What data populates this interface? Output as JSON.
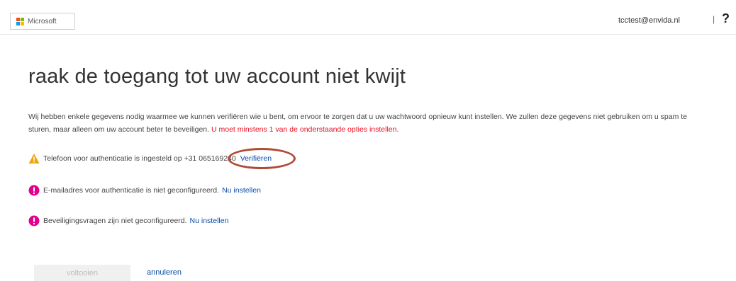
{
  "header": {
    "brand": "Microsoft",
    "user_email": "tcctest@envida.nl",
    "divider": "|",
    "help": "?"
  },
  "main": {
    "title": "raak de toegang tot uw account niet kwijt",
    "intro_text": "Wij hebben enkele gegevens nodig waarmee we kunnen verifiëren wie u bent, om ervoor te zorgen dat u uw wachtwoord opnieuw kunt instellen. We zullen deze gegevens niet gebruiken om u spam te sturen, maar alleen om uw account beter te beveiligen.",
    "intro_warning": "U moet minstens 1 van de onderstaande opties instellen.",
    "items": [
      {
        "icon": "warning-icon",
        "text": "Telefoon voor authenticatie is ingesteld op +31 065169240",
        "link": "Verifiëren"
      },
      {
        "icon": "error-icon",
        "text": "E-mailadres voor authenticatie is niet geconfigureerd.",
        "link": "Nu instellen"
      },
      {
        "icon": "error-icon",
        "text": "Beveiligingsvragen zijn niet geconfigureerd.",
        "link": "Nu instellen"
      }
    ]
  },
  "footer": {
    "finish_label": "voltooien",
    "cancel_label": "annuleren"
  },
  "colors": {
    "warning_red": "#e81123",
    "link_blue": "#0a4ca8",
    "warning_orange": "#f0a30a",
    "error_magenta": "#e3008c",
    "annotation_circle": "#b04a35"
  }
}
